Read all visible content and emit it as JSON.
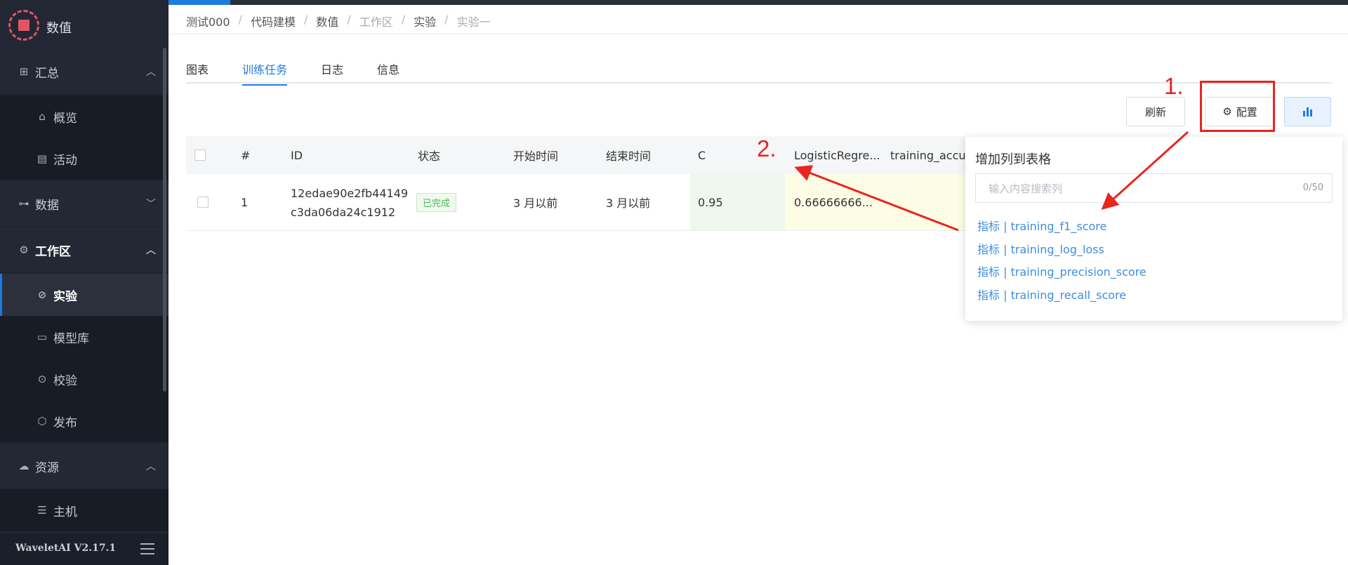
{
  "app": {
    "name": "数值",
    "version": "WaveletAI V2.17.1"
  },
  "sidebar": {
    "groups": [
      {
        "label": "汇总",
        "icon": "grid-icon"
      },
      {
        "label": "数据",
        "icon": "sitemap-icon"
      },
      {
        "label": "工作区",
        "icon": "chip-icon"
      },
      {
        "label": "资源",
        "icon": "cloud-icon"
      }
    ],
    "items": [
      {
        "label": "概览",
        "icon": "home-icon"
      },
      {
        "label": "活动",
        "icon": "card-icon"
      },
      {
        "label": "实验",
        "icon": "experiment-icon"
      },
      {
        "label": "模型库",
        "icon": "model-icon"
      },
      {
        "label": "校验",
        "icon": "scan-icon"
      },
      {
        "label": "发布",
        "icon": "box-icon"
      },
      {
        "label": "主机",
        "icon": "server-icon"
      }
    ]
  },
  "breadcrumb": [
    "测试000",
    "代码建模",
    "数值",
    "工作区",
    "实验",
    "实验一"
  ],
  "tabs": [
    "图表",
    "训练任务",
    "日志",
    "信息"
  ],
  "toolbar": {
    "refresh_label": "刷新",
    "config_label": "配置"
  },
  "table": {
    "columns": [
      "#",
      "ID",
      "状态",
      "开始时间",
      "结束时间",
      "C",
      "LogisticRegre...",
      "training_accu..."
    ],
    "rows": [
      {
        "index": "1",
        "id_line1": "12edae90e2fb44149",
        "id_line2": "c3da06da24c1912",
        "status": "已完成",
        "start": "3 月以前",
        "end": "3 月以前",
        "c": "0.95",
        "logistic": "0.66666666..."
      }
    ]
  },
  "panel": {
    "title": "增加列到表格",
    "search_placeholder": "输入内容搜索列",
    "count": "0/50",
    "items": [
      "指标 | training_f1_score",
      "指标 | training_log_loss",
      "指标 | training_precision_score",
      "指标 | training_recall_score"
    ]
  },
  "annotations": {
    "step1": "1.",
    "step2": "2.",
    "color": "#e8251f"
  },
  "colors": {
    "accent": "#1f7ae0",
    "sidebar_bg": "#1f2430",
    "link": "#3d8ede",
    "success": "#52b85a"
  }
}
